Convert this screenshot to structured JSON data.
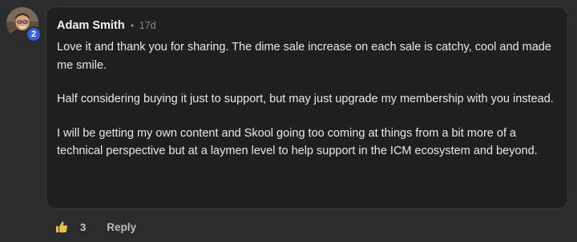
{
  "comment": {
    "author": {
      "name": "Adam Smith",
      "level": "2"
    },
    "separator": "•",
    "time_ago": "17d",
    "paragraphs": [
      "Love it and thank you for sharing. The dime sale increase on each sale is catchy, cool and made me smile.",
      "Half considering buying it just to support, but may just upgrade my membership with you instead.",
      "I will be getting my own content and Skool going too coming at things from a bit more of a technical perspective but at a laymen level to help support in the ICM ecosystem and beyond."
    ],
    "actions": {
      "like_icon": "thumbs-up-icon",
      "like_count": "3",
      "reply_label": "Reply"
    }
  },
  "colors": {
    "page_background": "#2b2b2b",
    "bubble_background": "#1f1f1f",
    "level_badge": "#3a5fd9",
    "like_icon": "#e8c050"
  }
}
